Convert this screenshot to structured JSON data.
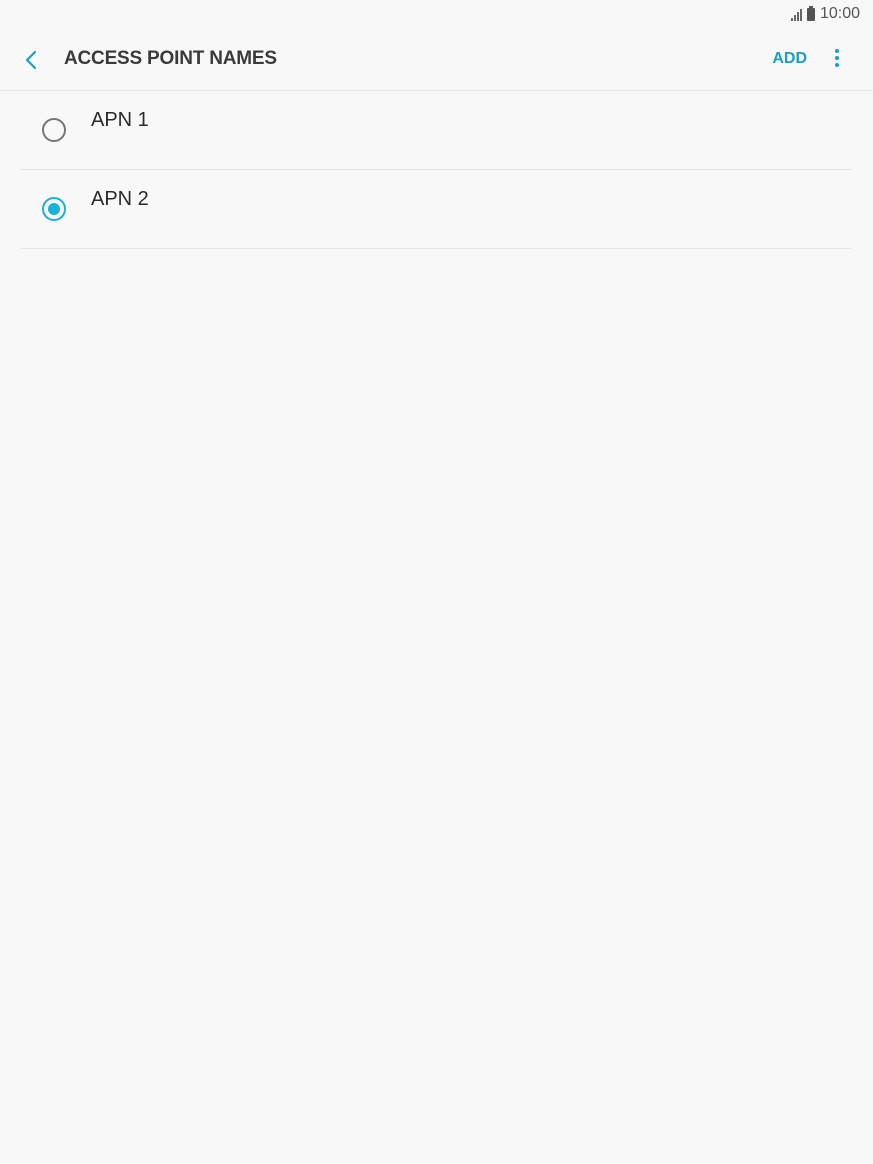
{
  "status_bar": {
    "time": "10:00",
    "signal_icon": "signal-icon",
    "battery_icon": "battery-icon"
  },
  "app_bar": {
    "back_icon": "chevron-left-icon",
    "title": "ACCESS POINT NAMES",
    "add_label": "ADD",
    "more_icon": "more-vertical-icon"
  },
  "apn_list": {
    "items": [
      {
        "label": "APN 1",
        "selected": false
      },
      {
        "label": "APN 2",
        "selected": true
      }
    ]
  },
  "colors": {
    "accent": "#1a9fc0",
    "radio_selected": "#1ab0d8",
    "background": "#f8f8f8"
  }
}
